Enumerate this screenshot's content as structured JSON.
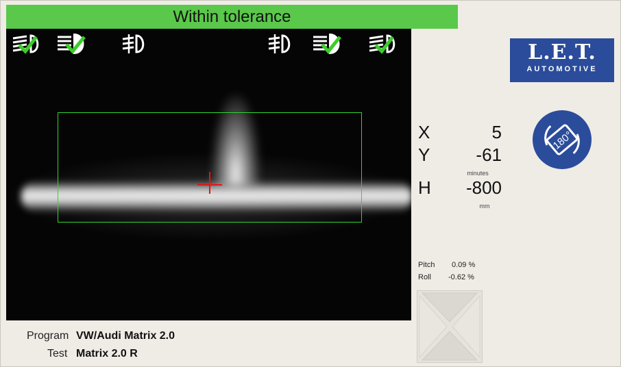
{
  "status": {
    "text": "Within tolerance",
    "color": "#5ac84a"
  },
  "lamp_icons_left": [
    {
      "name": "low-beam-lamp-icon",
      "checked": true
    },
    {
      "name": "high-beam-lamp-icon",
      "checked": true
    },
    {
      "name": "fog-lamp-icon",
      "checked": false
    }
  ],
  "lamp_icons_right": [
    {
      "name": "fog-lamp-icon",
      "checked": false
    },
    {
      "name": "high-beam-lamp-icon",
      "checked": true
    },
    {
      "name": "low-beam-lamp-icon",
      "checked": true
    }
  ],
  "readout": {
    "x_label": "X",
    "x_value": "5",
    "y_label": "Y",
    "y_value": "-61",
    "y_unit": "minutes",
    "h_label": "H",
    "h_value": "-800",
    "h_unit": "mm"
  },
  "attitude": {
    "pitch_label": "Pitch",
    "pitch_value": "0.09 %",
    "roll_label": "Roll",
    "roll_value": "-0.62 %"
  },
  "logo": {
    "main": "L.E.T.",
    "sub": "AUTOMOTIVE",
    "color": "#2b4c9b"
  },
  "rotate_button": {
    "label": "180°",
    "icon": "rotate-180-icon",
    "color": "#2b4c9b"
  },
  "program": {
    "program_label": "Program",
    "program_value": "VW/Audi Matrix 2.0",
    "test_label": "Test",
    "test_value": "Matrix 2.0 R"
  },
  "colors": {
    "tolerance_box": "#2ed82e",
    "crosshair": "#ee1111",
    "check": "#3bcc2a"
  }
}
